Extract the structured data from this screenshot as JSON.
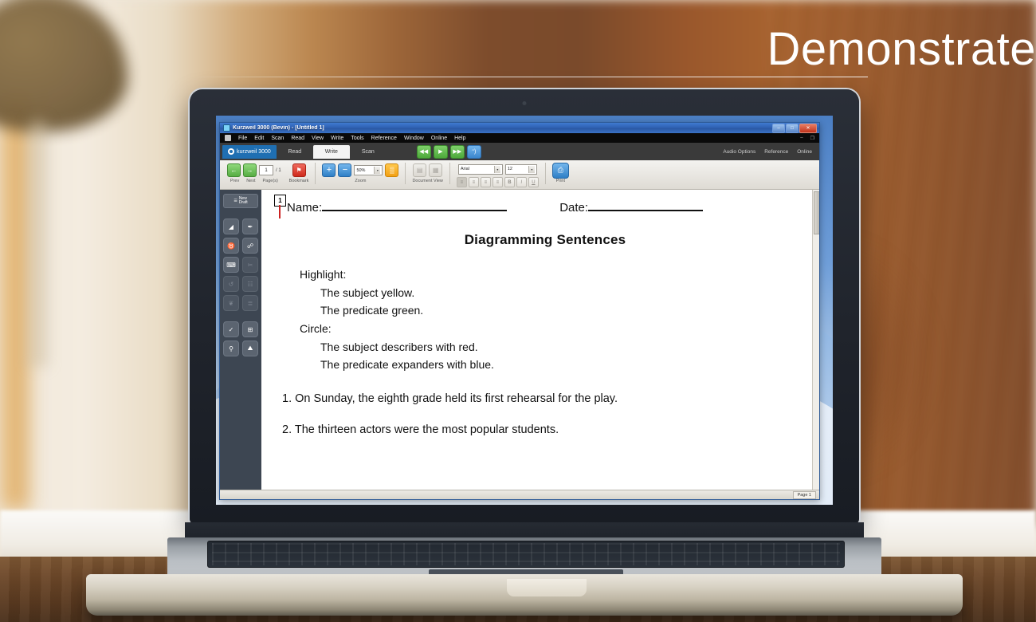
{
  "headline": {
    "text": "Demonstrate"
  },
  "window": {
    "title": "Kurzweil 3000 (Bevin) - [Untitled 1]",
    "controls": {
      "minimize": "–",
      "maximize": "□",
      "close": "✕"
    },
    "inner_controls": {
      "minimize": "–",
      "restore": "❐"
    }
  },
  "menubar": {
    "items": [
      "File",
      "Edit",
      "Scan",
      "Read",
      "View",
      "Write",
      "Tools",
      "Reference",
      "Window",
      "Online",
      "Help"
    ]
  },
  "ribbon": {
    "brand": "kurzweil 3000",
    "tabs": [
      {
        "label": "Read",
        "active": false
      },
      {
        "label": "Write",
        "active": true
      },
      {
        "label": "Scan",
        "active": false
      }
    ],
    "transport": [
      {
        "name": "rewind-button",
        "glyph": "◀◀"
      },
      {
        "name": "play-button",
        "glyph": "▶"
      },
      {
        "name": "forward-button",
        "glyph": "▶▶"
      },
      {
        "name": "speaker-button",
        "glyph": "ᵔ)"
      }
    ],
    "links": [
      "Audio Options",
      "Reference",
      "Online"
    ]
  },
  "toolbar": {
    "nav": {
      "prev_label": "Prev",
      "next_label": "Next",
      "prev_glyph": "←",
      "next_glyph": "→",
      "page_value": "1",
      "page_total": "/ 1",
      "pages_label": "Page(s)"
    },
    "bookmark": {
      "label": "Bookmark",
      "glyph": "⚑"
    },
    "zoom": {
      "label": "Zoom",
      "in_glyph": "+",
      "out_glyph": "−",
      "value": "50%",
      "grid_glyph": "▒"
    },
    "document_view": {
      "label": "Document View",
      "buttons": [
        "▤",
        "▦"
      ]
    },
    "format": {
      "font_family": "Arial",
      "font_size": "12",
      "align_buttons": [
        "≡",
        "≡",
        "≡",
        "≡"
      ],
      "bold": "B",
      "italic": "I",
      "underline": "U"
    },
    "print": {
      "label": "Print",
      "glyph": "⎙"
    }
  },
  "sidebar": {
    "new_draft": {
      "top_label": "New",
      "label": "Draft",
      "glyph": "☰"
    },
    "tools": [
      {
        "name": "eraser-tool",
        "glyph": "◢",
        "dim": false
      },
      {
        "name": "highlighter-tool",
        "glyph": "✒",
        "dim": false
      },
      {
        "name": "microphone-tool",
        "glyph": "♉",
        "dim": false
      },
      {
        "name": "paperclip-tool",
        "glyph": "☍",
        "dim": false
      },
      {
        "name": "keyboard-tool",
        "glyph": "⌨",
        "dim": false
      },
      {
        "name": "scissors-tool",
        "glyph": "✂",
        "dim": true
      },
      {
        "name": "undo-tool",
        "glyph": "↺",
        "dim": true
      },
      {
        "name": "document-tool",
        "glyph": "☷",
        "dim": true
      },
      {
        "name": "tag-tool",
        "glyph": "❦",
        "dim": true
      },
      {
        "name": "list-tool",
        "glyph": "≣",
        "dim": true
      },
      {
        "name": "spellcheck-tool",
        "glyph": "✓",
        "dim": false
      },
      {
        "name": "calculator-tool",
        "glyph": "⊞",
        "dim": false
      },
      {
        "name": "magnifier-tool",
        "glyph": "⚲",
        "dim": false
      },
      {
        "name": "image-tool",
        "glyph": "⛰",
        "dim": false
      }
    ]
  },
  "document": {
    "page_marker": "1",
    "header": {
      "name_label": "Name:",
      "date_label": "Date:"
    },
    "title": "Diagramming Sentences",
    "instructions": [
      {
        "text": "Highlight:",
        "indent": 0
      },
      {
        "text": "The subject yellow.",
        "indent": 1
      },
      {
        "text": "The predicate green.",
        "indent": 1
      },
      {
        "text": "Circle:",
        "indent": 0
      },
      {
        "text": "The subject describers with red.",
        "indent": 1
      },
      {
        "text": "The predicate expanders with blue.",
        "indent": 1
      }
    ],
    "questions": [
      "1. On Sunday, the eighth grade held its first rehearsal for the play.",
      "2. The thirteen actors were the most popular students."
    ]
  },
  "statusbar": {
    "page": "Page 1"
  },
  "colors": {
    "accent_blue": "#2f7fc6",
    "ribbon_dark": "#3a3a3a",
    "sidebar": "#3d4652",
    "green": "#56ad42",
    "red": "#cf2a1c",
    "orange": "#f2a013",
    "title_blue": "#2f62b4"
  }
}
